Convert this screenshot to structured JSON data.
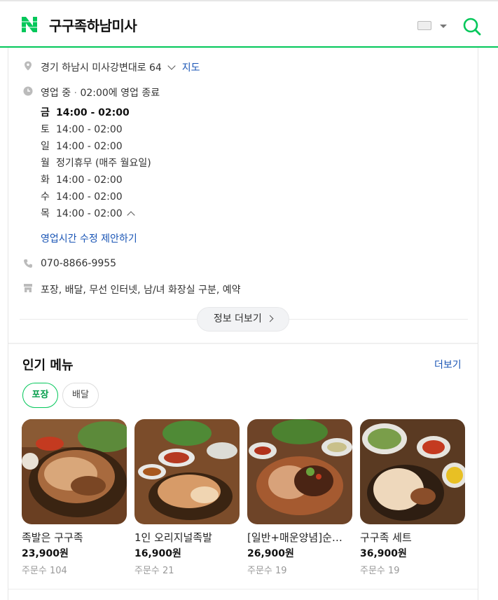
{
  "header": {
    "title": "구구족하남미사"
  },
  "info": {
    "address": "경기 하남시 미사강변대로 64",
    "map_link": "지도",
    "status": "영업 중",
    "status_detail": "02:00에 영업 종료",
    "hours": [
      {
        "day": "금",
        "time": "14:00 - 02:00"
      },
      {
        "day": "토",
        "time": "14:00 - 02:00"
      },
      {
        "day": "일",
        "time": "14:00 - 02:00"
      },
      {
        "day": "월",
        "time": "정기휴무 (매주 월요일)"
      },
      {
        "day": "화",
        "time": "14:00 - 02:00"
      },
      {
        "day": "수",
        "time": "14:00 - 02:00"
      },
      {
        "day": "목",
        "time": "14:00 - 02:00"
      }
    ],
    "edit_hours_link": "영업시간 수정 제안하기",
    "phone": "070-8866-9955",
    "amenities": "포장, 배달, 무선 인터넷, 남/녀 화장실 구분, 예약",
    "more_info_button": "정보 더보기"
  },
  "menu": {
    "title": "인기 메뉴",
    "more_link": "더보기",
    "chips": [
      "포장",
      "배달"
    ],
    "items": [
      {
        "name": "족발은 구구족",
        "price": "23,900원",
        "orders": "주문수 104"
      },
      {
        "name": "1인 오리지널족발",
        "price": "16,900원",
        "orders": "주문수 21"
      },
      {
        "name": "[일반+매운양념]순살족발",
        "price": "26,900원",
        "orders": "주문수 19"
      },
      {
        "name": "구구족 세트",
        "price": "36,900원",
        "orders": "주문수 19"
      }
    ]
  },
  "colors": {
    "brand_green": "#03c75a",
    "link_blue": "#1a55b5"
  }
}
